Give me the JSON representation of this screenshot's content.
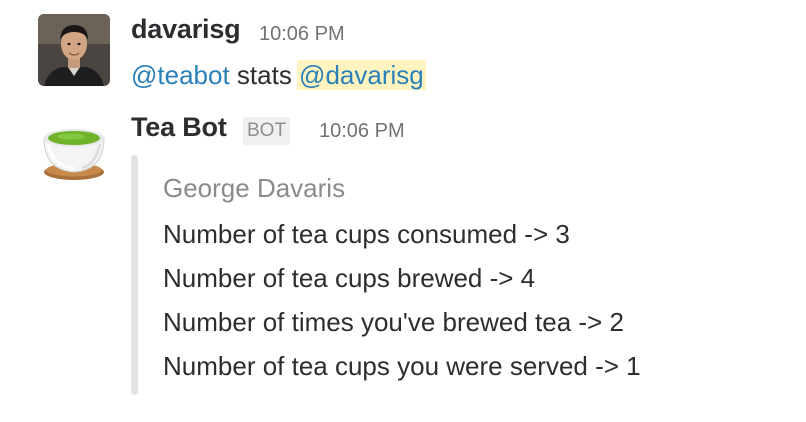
{
  "messages": [
    {
      "sender": "davarisg",
      "timestamp": "10:06 PM",
      "avatar_icon": "user-photo-avatar",
      "text": {
        "mention_bot": "@teabot",
        "middle": " stats ",
        "mention_user": "@davarisg"
      }
    },
    {
      "sender": "Tea Bot",
      "badge": "BOT",
      "timestamp": "10:06 PM",
      "avatar_icon": "tea-cup-icon",
      "attachment": {
        "title": "George Davaris",
        "lines": [
          "Number of tea cups consumed -> 3",
          "Number of tea cups brewed -> 4",
          "Number of times you've brewed tea -> 2",
          "Number of tea cups you were served -> 1"
        ]
      }
    }
  ],
  "colors": {
    "mention": "#2a80b9",
    "mention_highlight": "#fff4c0",
    "timestamp": "#717274",
    "attachment_bar": "#e3e3e3"
  }
}
